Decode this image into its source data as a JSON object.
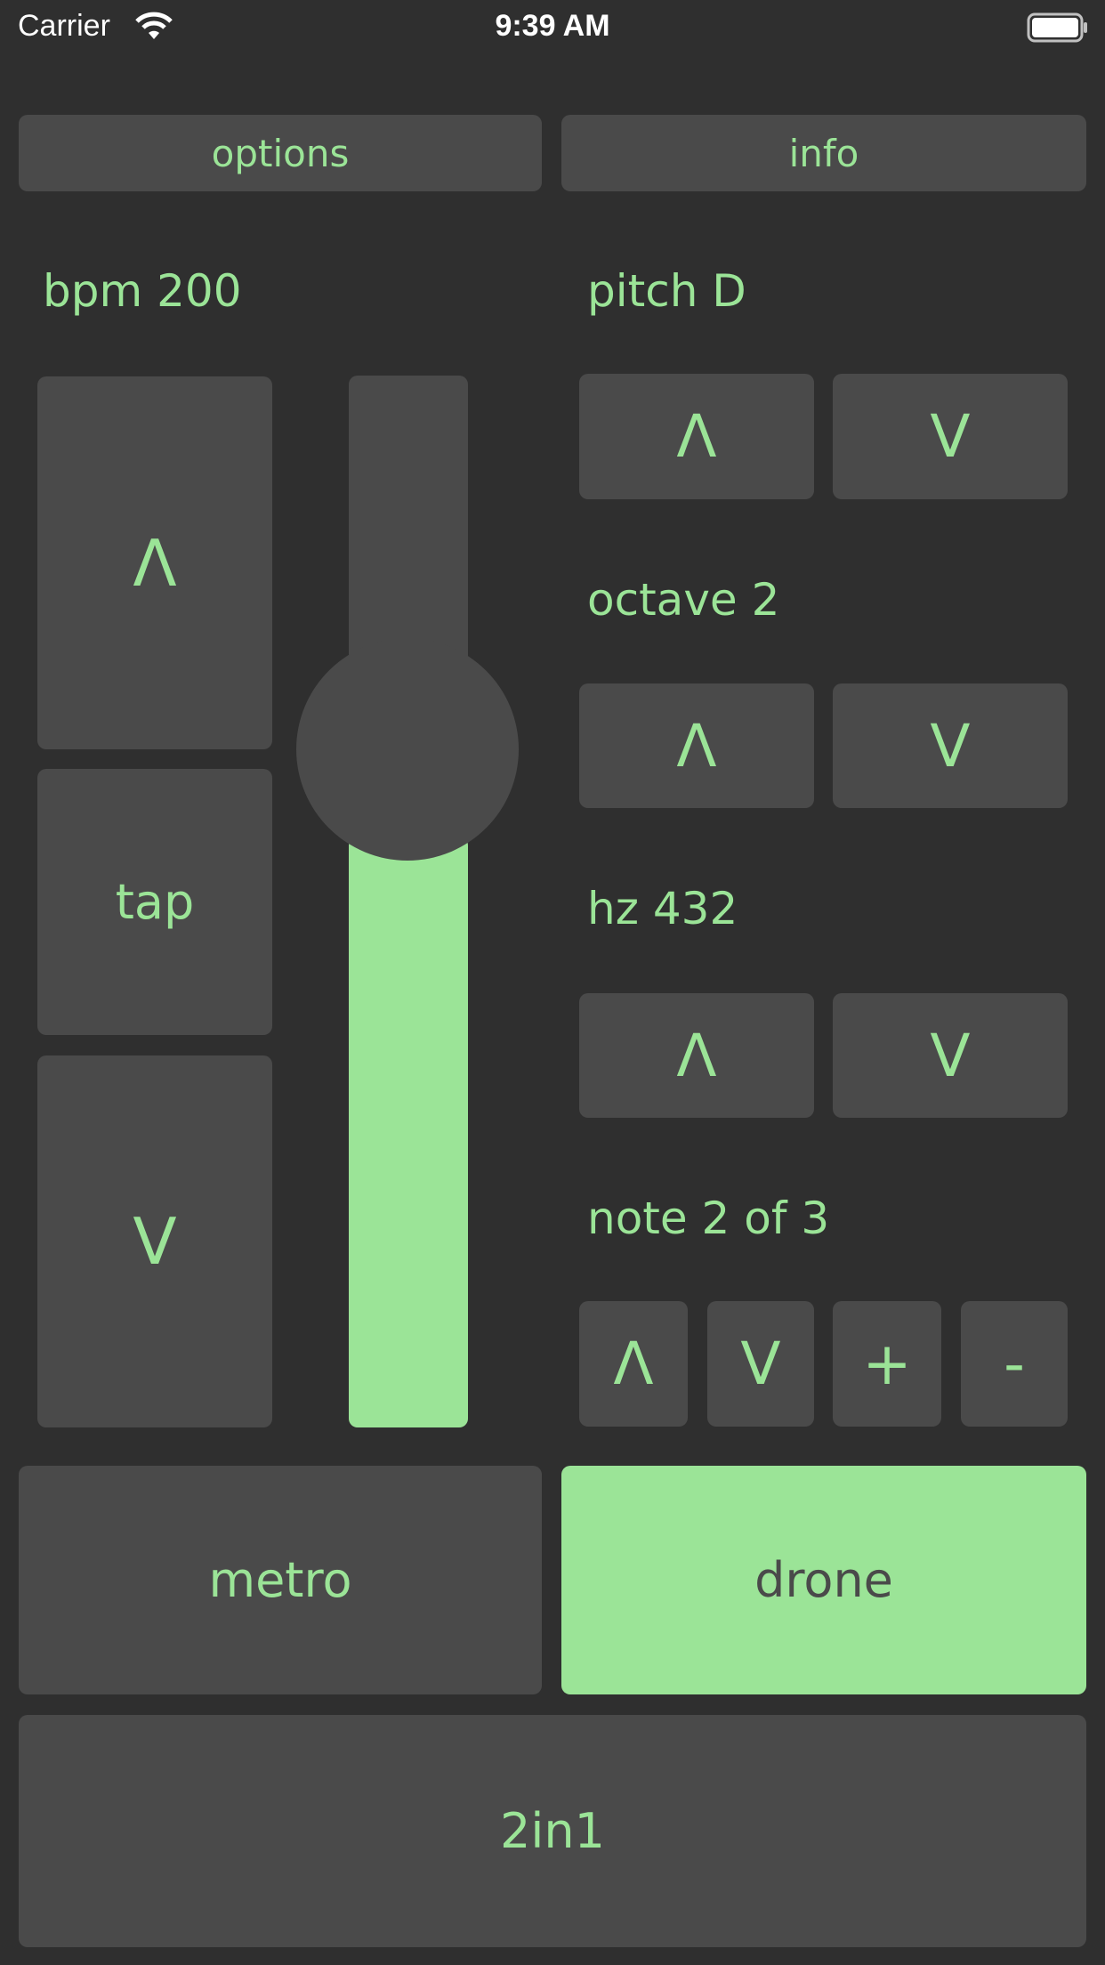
{
  "status_bar": {
    "carrier": "Carrier",
    "time": "9:39 AM"
  },
  "top": {
    "options_label": "options",
    "info_label": "info"
  },
  "bpm": {
    "label": "bpm 200",
    "up_label": "Λ",
    "tap_label": "tap",
    "down_label": "V",
    "slider_level": 0.56
  },
  "pitch": {
    "label": "pitch D",
    "up_label": "Λ",
    "down_label": "V"
  },
  "octave": {
    "label": "octave 2",
    "up_label": "Λ",
    "down_label": "V"
  },
  "hz": {
    "label": "hz 432",
    "up_label": "Λ",
    "down_label": "V"
  },
  "note": {
    "label": "note 2 of 3",
    "up_label": "Λ",
    "down_label": "V",
    "add_label": "+",
    "remove_label": "-"
  },
  "modes": {
    "metro_label": "metro",
    "drone_label": "drone",
    "combo_label": "2in1",
    "active": "drone"
  },
  "colors": {
    "background": "#2f2f2f",
    "button": "#4a4a4a",
    "accent": "#9be497"
  }
}
